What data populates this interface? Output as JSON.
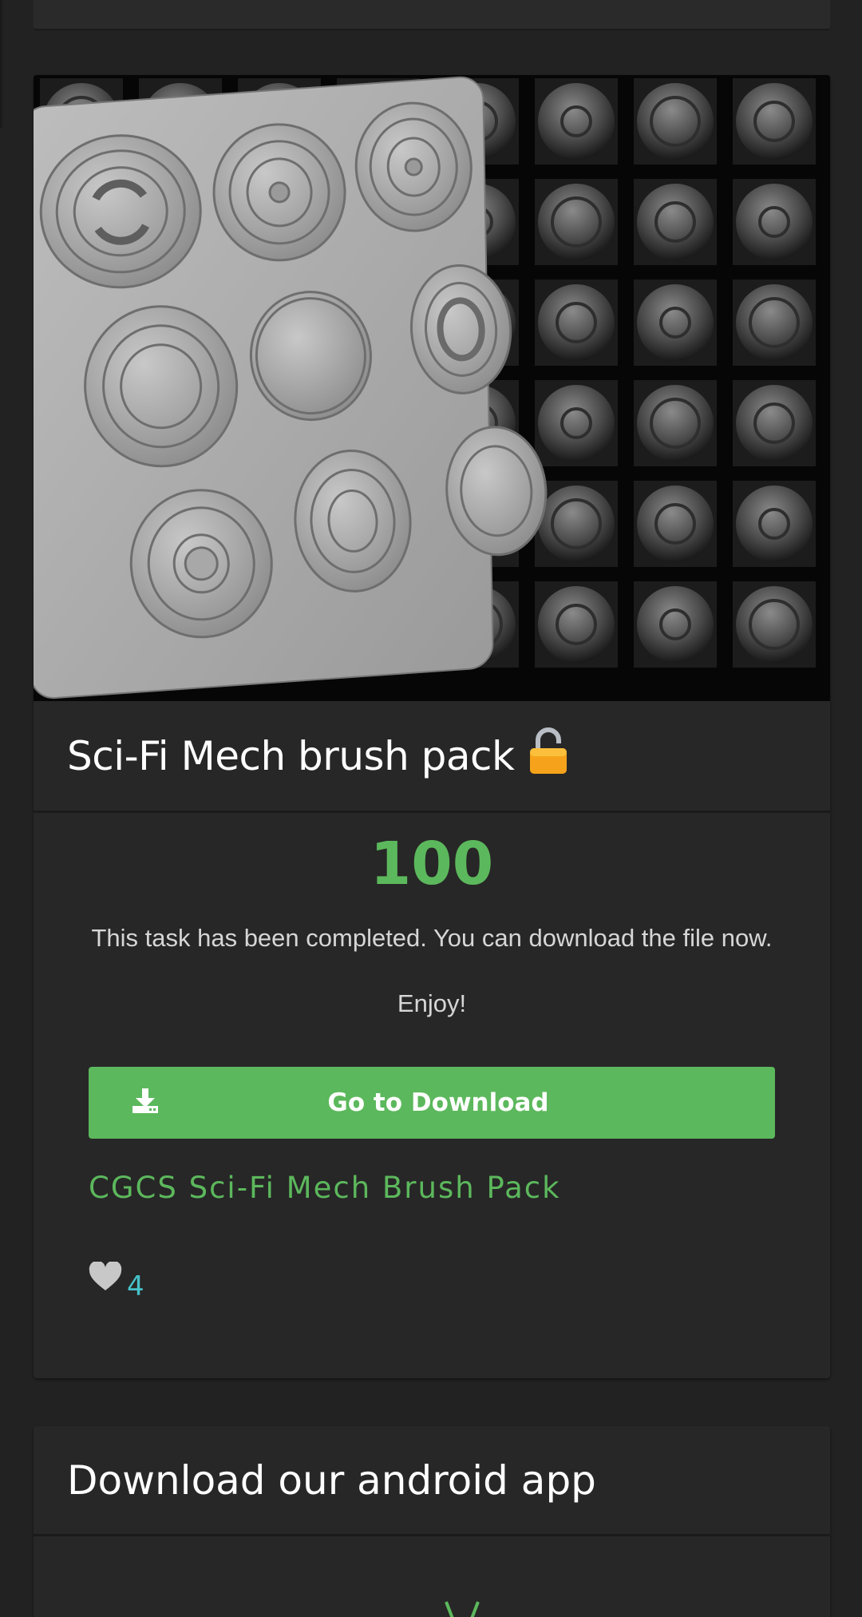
{
  "product": {
    "title": "Sci-Fi Mech brush pack",
    "lock_icon": "unlocked-padlock-icon",
    "image_alt": "Sci-Fi Mech brush pack preview"
  },
  "task": {
    "score": "100",
    "message": "This task has been completed. You can download the file now. Enjoy!",
    "score_color": "#5cb85c"
  },
  "download": {
    "icon": "download-icon",
    "label": "Go to Download",
    "color": "#5cb85c"
  },
  "pack_link": {
    "text": "CGCS Sci-Fi Mech Brush Pack"
  },
  "likes": {
    "icon": "heart-icon",
    "count": "4"
  },
  "app_section": {
    "title": "Download our android app",
    "icon": "android-icon"
  }
}
